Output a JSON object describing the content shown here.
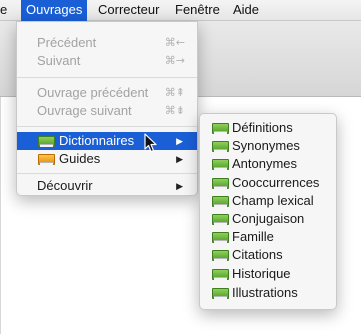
{
  "menubar": {
    "items": [
      {
        "label": "e"
      },
      {
        "label": "Ouvrages"
      },
      {
        "label": "Correcteur"
      },
      {
        "label": "Fenêtre"
      },
      {
        "label": "Aide"
      }
    ]
  },
  "ouvrages_menu": {
    "precedent": {
      "label": "Précédent",
      "shortcut": "⌘←"
    },
    "suivant": {
      "label": "Suivant",
      "shortcut": "⌘→"
    },
    "ouvrage_precedent": {
      "label": "Ouvrage précédent",
      "shortcut": "⌘⇞"
    },
    "ouvrage_suivant": {
      "label": "Ouvrage suivant",
      "shortcut": "⌘⇟"
    },
    "dictionnaires": {
      "label": "Dictionnaires",
      "arrow": "▶"
    },
    "guides": {
      "label": "Guides",
      "arrow": "▶"
    },
    "decouvrir": {
      "label": "Découvrir",
      "arrow": "▶"
    }
  },
  "dictionnaires_submenu": {
    "items": [
      {
        "label": "Définitions"
      },
      {
        "label": "Synonymes"
      },
      {
        "label": "Antonymes"
      },
      {
        "label": "Cooccurrences"
      },
      {
        "label": "Champ lexical"
      },
      {
        "label": "Conjugaison"
      },
      {
        "label": "Famille"
      },
      {
        "label": "Citations"
      },
      {
        "label": "Historique"
      },
      {
        "label": "Illustrations"
      }
    ]
  },
  "colors": {
    "highlight": "#1a5fd6",
    "book_green": "#5aab2e",
    "book_orange": "#f29a0c"
  },
  "icons": {
    "dictionary": "green-book-icon",
    "guides": "orange-book-icon",
    "cursor": "mouse-pointer-icon"
  }
}
